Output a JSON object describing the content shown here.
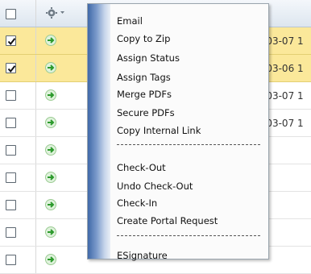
{
  "grid": {
    "rows": [
      {
        "checked": false,
        "header": true
      },
      {
        "checked": true,
        "selected": true,
        "date": "-03-07 1"
      },
      {
        "checked": true,
        "selected": true,
        "date": "-03-06 1"
      },
      {
        "checked": false,
        "date": "-03-07 1"
      },
      {
        "checked": false,
        "date": "-03-07 1"
      },
      {
        "checked": false,
        "date": ""
      },
      {
        "checked": false,
        "date": ""
      },
      {
        "checked": false,
        "date": ""
      },
      {
        "checked": false,
        "date": ""
      }
    ]
  },
  "menu": {
    "items": [
      "Email",
      "Copy to Zip",
      "Assign Status",
      "Assign Tags",
      "Merge PDFs",
      "Secure PDFs",
      "Copy Internal Link",
      "Check-Out",
      "Undo Check-Out",
      "Check-In",
      "Create Portal Request",
      "ESignature"
    ]
  },
  "colors": {
    "selected_row": "#fbe89a",
    "menu_bar": "#3f69a8",
    "go_icon": "#3aa33a"
  }
}
